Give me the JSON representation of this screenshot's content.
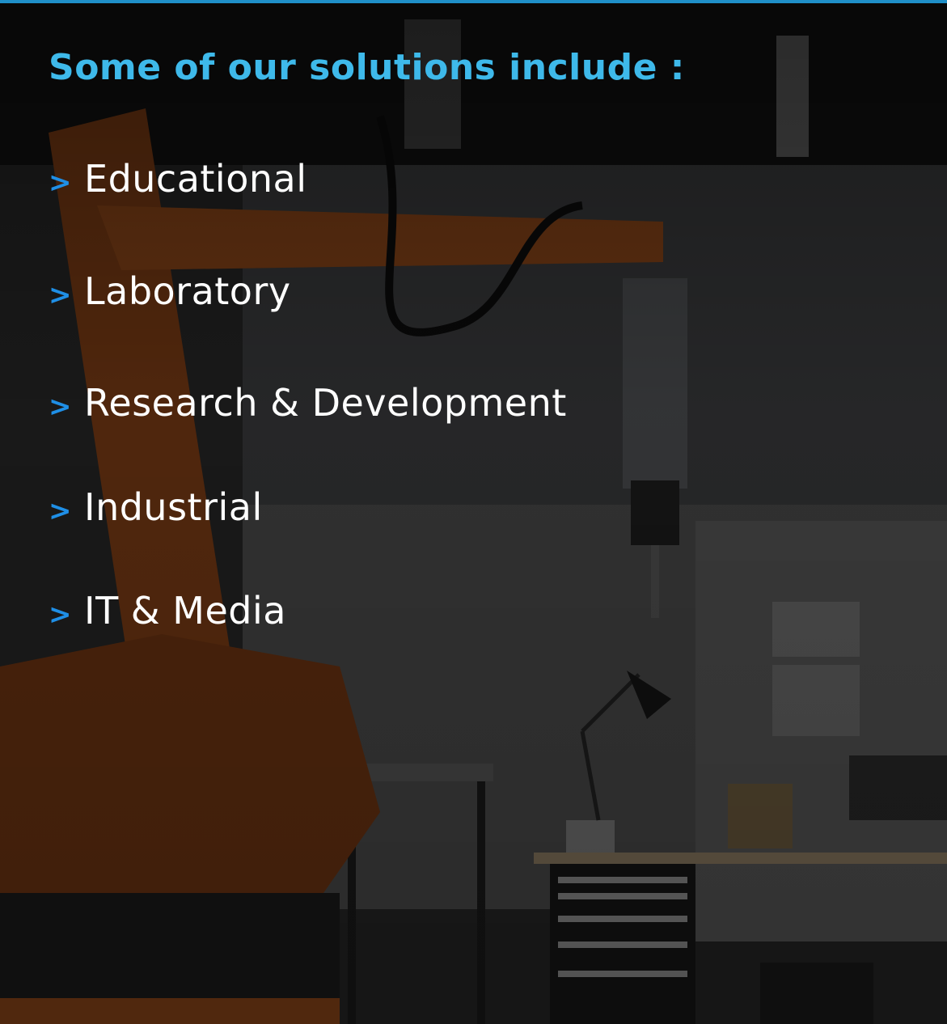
{
  "heading": "Some of our solutions include :",
  "items": [
    {
      "marker": ">",
      "label": "Educational"
    },
    {
      "marker": ">",
      "label": "Laboratory"
    },
    {
      "marker": ">",
      "label": "Research & Development"
    },
    {
      "marker": ">",
      "label": "Industrial"
    },
    {
      "marker": ">",
      "label": "IT & Media"
    }
  ],
  "colors": {
    "heading": "#3eb9ea",
    "marker": "#1f8fe6",
    "item_text": "#ffffff",
    "top_border": "#1f8fc8"
  }
}
